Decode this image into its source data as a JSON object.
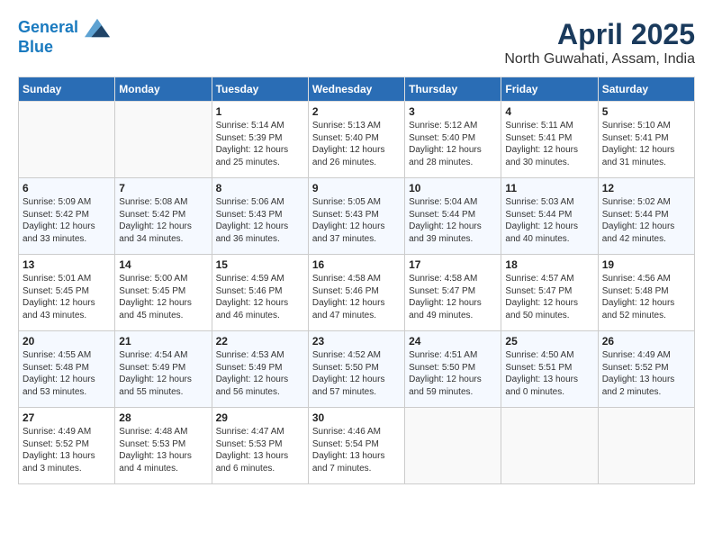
{
  "header": {
    "logo_line1": "General",
    "logo_line2": "Blue",
    "title": "April 2025",
    "subtitle": "North Guwahati, Assam, India"
  },
  "calendar": {
    "days_of_week": [
      "Sunday",
      "Monday",
      "Tuesday",
      "Wednesday",
      "Thursday",
      "Friday",
      "Saturday"
    ],
    "weeks": [
      [
        {
          "day": "",
          "info": ""
        },
        {
          "day": "",
          "info": ""
        },
        {
          "day": "1",
          "info": "Sunrise: 5:14 AM\nSunset: 5:39 PM\nDaylight: 12 hours\nand 25 minutes."
        },
        {
          "day": "2",
          "info": "Sunrise: 5:13 AM\nSunset: 5:40 PM\nDaylight: 12 hours\nand 26 minutes."
        },
        {
          "day": "3",
          "info": "Sunrise: 5:12 AM\nSunset: 5:40 PM\nDaylight: 12 hours\nand 28 minutes."
        },
        {
          "day": "4",
          "info": "Sunrise: 5:11 AM\nSunset: 5:41 PM\nDaylight: 12 hours\nand 30 minutes."
        },
        {
          "day": "5",
          "info": "Sunrise: 5:10 AM\nSunset: 5:41 PM\nDaylight: 12 hours\nand 31 minutes."
        }
      ],
      [
        {
          "day": "6",
          "info": "Sunrise: 5:09 AM\nSunset: 5:42 PM\nDaylight: 12 hours\nand 33 minutes."
        },
        {
          "day": "7",
          "info": "Sunrise: 5:08 AM\nSunset: 5:42 PM\nDaylight: 12 hours\nand 34 minutes."
        },
        {
          "day": "8",
          "info": "Sunrise: 5:06 AM\nSunset: 5:43 PM\nDaylight: 12 hours\nand 36 minutes."
        },
        {
          "day": "9",
          "info": "Sunrise: 5:05 AM\nSunset: 5:43 PM\nDaylight: 12 hours\nand 37 minutes."
        },
        {
          "day": "10",
          "info": "Sunrise: 5:04 AM\nSunset: 5:44 PM\nDaylight: 12 hours\nand 39 minutes."
        },
        {
          "day": "11",
          "info": "Sunrise: 5:03 AM\nSunset: 5:44 PM\nDaylight: 12 hours\nand 40 minutes."
        },
        {
          "day": "12",
          "info": "Sunrise: 5:02 AM\nSunset: 5:44 PM\nDaylight: 12 hours\nand 42 minutes."
        }
      ],
      [
        {
          "day": "13",
          "info": "Sunrise: 5:01 AM\nSunset: 5:45 PM\nDaylight: 12 hours\nand 43 minutes."
        },
        {
          "day": "14",
          "info": "Sunrise: 5:00 AM\nSunset: 5:45 PM\nDaylight: 12 hours\nand 45 minutes."
        },
        {
          "day": "15",
          "info": "Sunrise: 4:59 AM\nSunset: 5:46 PM\nDaylight: 12 hours\nand 46 minutes."
        },
        {
          "day": "16",
          "info": "Sunrise: 4:58 AM\nSunset: 5:46 PM\nDaylight: 12 hours\nand 47 minutes."
        },
        {
          "day": "17",
          "info": "Sunrise: 4:58 AM\nSunset: 5:47 PM\nDaylight: 12 hours\nand 49 minutes."
        },
        {
          "day": "18",
          "info": "Sunrise: 4:57 AM\nSunset: 5:47 PM\nDaylight: 12 hours\nand 50 minutes."
        },
        {
          "day": "19",
          "info": "Sunrise: 4:56 AM\nSunset: 5:48 PM\nDaylight: 12 hours\nand 52 minutes."
        }
      ],
      [
        {
          "day": "20",
          "info": "Sunrise: 4:55 AM\nSunset: 5:48 PM\nDaylight: 12 hours\nand 53 minutes."
        },
        {
          "day": "21",
          "info": "Sunrise: 4:54 AM\nSunset: 5:49 PM\nDaylight: 12 hours\nand 55 minutes."
        },
        {
          "day": "22",
          "info": "Sunrise: 4:53 AM\nSunset: 5:49 PM\nDaylight: 12 hours\nand 56 minutes."
        },
        {
          "day": "23",
          "info": "Sunrise: 4:52 AM\nSunset: 5:50 PM\nDaylight: 12 hours\nand 57 minutes."
        },
        {
          "day": "24",
          "info": "Sunrise: 4:51 AM\nSunset: 5:50 PM\nDaylight: 12 hours\nand 59 minutes."
        },
        {
          "day": "25",
          "info": "Sunrise: 4:50 AM\nSunset: 5:51 PM\nDaylight: 13 hours\nand 0 minutes."
        },
        {
          "day": "26",
          "info": "Sunrise: 4:49 AM\nSunset: 5:52 PM\nDaylight: 13 hours\nand 2 minutes."
        }
      ],
      [
        {
          "day": "27",
          "info": "Sunrise: 4:49 AM\nSunset: 5:52 PM\nDaylight: 13 hours\nand 3 minutes."
        },
        {
          "day": "28",
          "info": "Sunrise: 4:48 AM\nSunset: 5:53 PM\nDaylight: 13 hours\nand 4 minutes."
        },
        {
          "day": "29",
          "info": "Sunrise: 4:47 AM\nSunset: 5:53 PM\nDaylight: 13 hours\nand 6 minutes."
        },
        {
          "day": "30",
          "info": "Sunrise: 4:46 AM\nSunset: 5:54 PM\nDaylight: 13 hours\nand 7 minutes."
        },
        {
          "day": "",
          "info": ""
        },
        {
          "day": "",
          "info": ""
        },
        {
          "day": "",
          "info": ""
        }
      ]
    ]
  }
}
